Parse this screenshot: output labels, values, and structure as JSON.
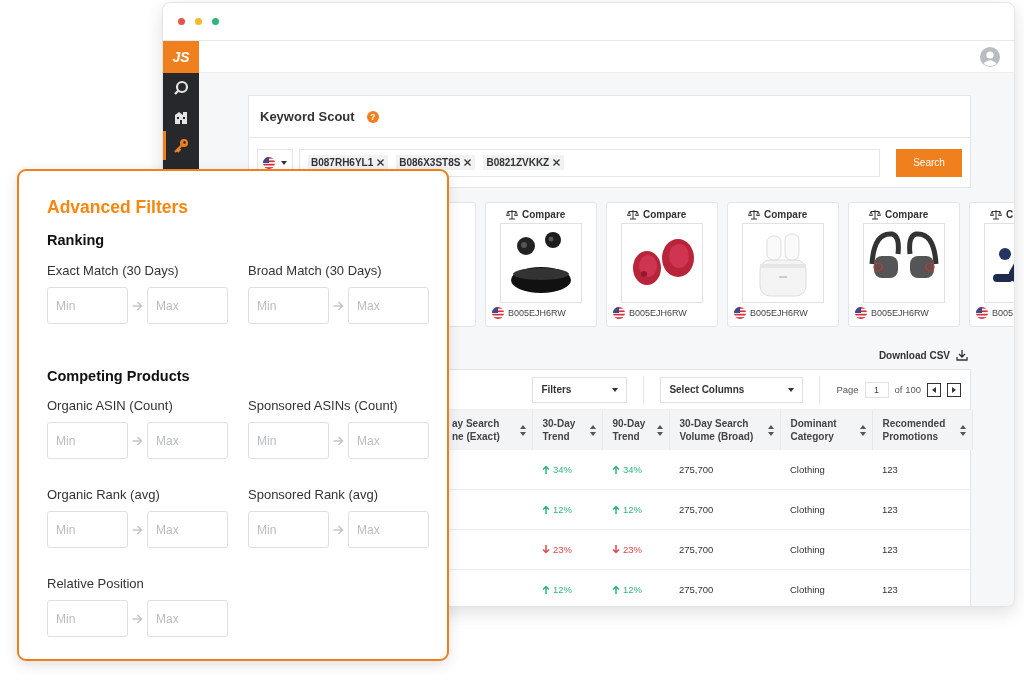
{
  "window": {
    "logo": "JS",
    "sidebar": [
      {
        "kind": "search",
        "selected": false
      },
      {
        "kind": "building",
        "selected": false
      },
      {
        "kind": "key",
        "selected": true
      }
    ]
  },
  "keyword_scout": {
    "title": "Keyword Scout",
    "help": "?",
    "tags": [
      "B087RH6YL1",
      "B086X3ST8S",
      "B0821ZVKKZ"
    ],
    "search_button": "Search"
  },
  "products": [
    {
      "kind": "partial"
    },
    {
      "kind": "full",
      "compare": "Compare",
      "asin": "B005EJH6RW"
    },
    {
      "kind": "full",
      "compare": "Compare",
      "asin": "B005EJH6RW"
    },
    {
      "kind": "full",
      "compare": "Compare",
      "asin": "B005EJH6RW"
    },
    {
      "kind": "full",
      "compare": "Compare",
      "asin": "B005EJH6RW"
    },
    {
      "kind": "full",
      "compare": "C",
      "asin": "B005"
    }
  ],
  "download_csv": "Download CSV",
  "table": {
    "filters": "Filters",
    "select_columns": "Select Columns",
    "page_label": "Page",
    "page": "1",
    "page_total": "of 100",
    "columns": [
      "ay Search\nne (Exact)",
      "30-Day\nTrend",
      "90-Day\nTrend",
      "30-Day Search\nVolume (Broad)",
      "Dominant\nCategory",
      "Recomended\nPromotions"
    ],
    "rows": [
      {
        "cells": [
          {
            "kind": "empty"
          },
          {
            "kind": "trend_up",
            "text": "34%"
          },
          {
            "kind": "trend_up",
            "text": "34%"
          },
          {
            "kind": "text",
            "text": "275,700"
          },
          {
            "kind": "text",
            "text": "Clothing"
          },
          {
            "kind": "text",
            "text": "123"
          }
        ]
      },
      {
        "cells": [
          {
            "kind": "empty"
          },
          {
            "kind": "trend_up",
            "text": "12%"
          },
          {
            "kind": "trend_up",
            "text": "12%"
          },
          {
            "kind": "text",
            "text": "275,700"
          },
          {
            "kind": "text",
            "text": "Clothing"
          },
          {
            "kind": "text",
            "text": "123"
          }
        ]
      },
      {
        "cells": [
          {
            "kind": "empty"
          },
          {
            "kind": "trend_down",
            "text": "23%"
          },
          {
            "kind": "trend_down",
            "text": "23%"
          },
          {
            "kind": "text",
            "text": "275,700"
          },
          {
            "kind": "text",
            "text": "Clothing"
          },
          {
            "kind": "text",
            "text": "123"
          }
        ]
      },
      {
        "cells": [
          {
            "kind": "empty"
          },
          {
            "kind": "trend_up",
            "text": "12%"
          },
          {
            "kind": "trend_up",
            "text": "12%"
          },
          {
            "kind": "text",
            "text": "275,700"
          },
          {
            "kind": "text",
            "text": "Clothing"
          },
          {
            "kind": "text",
            "text": "123"
          }
        ]
      }
    ]
  },
  "advanced_filters": {
    "title": "Advanced Filters",
    "sections": [
      {
        "heading": "Ranking",
        "fields": [
          {
            "label": "Exact Match (30 Days)",
            "min_placeholder": "Min",
            "max_placeholder": "Max"
          },
          {
            "label": "Broad Match (30 Days)",
            "min_placeholder": "Min",
            "max_placeholder": "Max"
          }
        ]
      },
      {
        "heading": "Competing Products",
        "fields": [
          {
            "label": "Organic ASIN (Count)",
            "min_placeholder": "Min",
            "max_placeholder": "Max"
          },
          {
            "label": "Sponsored ASINs (Count)",
            "min_placeholder": "Min",
            "max_placeholder": "Max"
          },
          {
            "label": "Organic Rank (avg)",
            "min_placeholder": "Min",
            "max_placeholder": "Max"
          },
          {
            "label": "Sponsored Rank (avg)",
            "min_placeholder": "Min",
            "max_placeholder": "Max"
          },
          {
            "label": "Relative Position",
            "min_placeholder": "Min",
            "max_placeholder": "Max"
          }
        ]
      }
    ]
  }
}
